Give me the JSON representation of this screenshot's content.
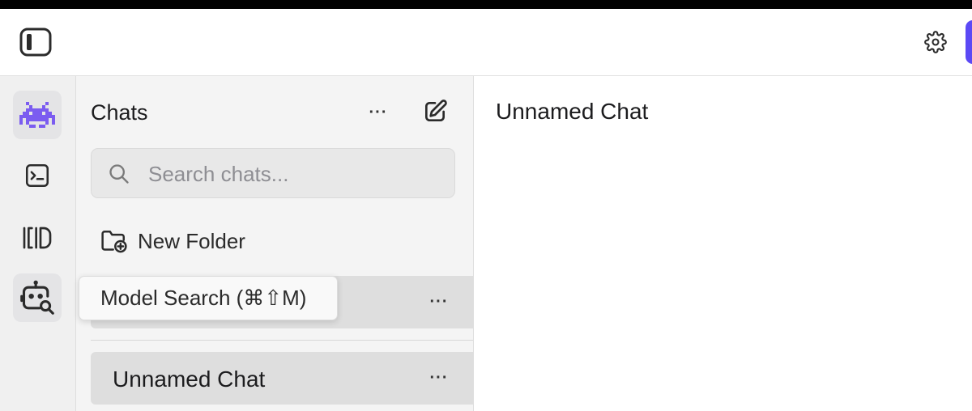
{
  "header": {
    "sidebar_toggle_icon": "sidebar-icon",
    "settings_icon": "gear-icon",
    "accent_color": "#5b49f5"
  },
  "rail": {
    "items": [
      {
        "icon": "robot-mascot-icon",
        "active": true
      },
      {
        "icon": "terminal-icon",
        "active": false
      },
      {
        "icon": "library-icon",
        "active": false
      },
      {
        "icon": "model-search-icon",
        "active": false
      }
    ],
    "tooltip": "Model Search (⌘⇧M)"
  },
  "chats": {
    "title": "Chats",
    "more_label": "···",
    "search_placeholder": "Search chats...",
    "new_folder_label": "New Folder",
    "items": [
      {
        "label": "",
        "more_label": "···"
      },
      {
        "label": "Unnamed Chat",
        "more_label": "···"
      }
    ]
  },
  "main": {
    "title": "Unnamed Chat"
  }
}
